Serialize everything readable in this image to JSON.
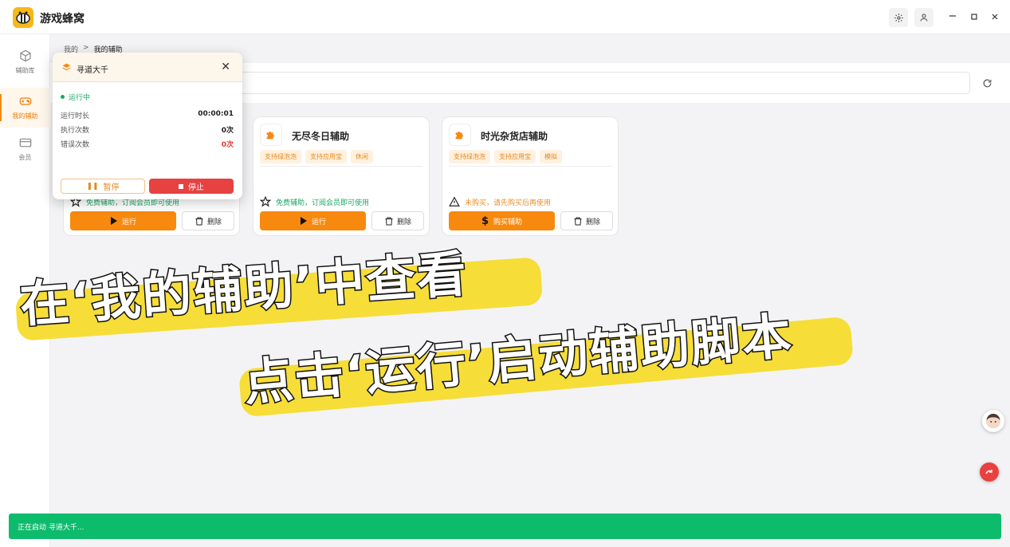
{
  "app": {
    "title": "游戏蜂窝"
  },
  "sidebar": {
    "items": [
      {
        "label": "辅助库",
        "icon": "cube-icon",
        "active": false
      },
      {
        "label": "我的辅助",
        "icon": "gamepad-icon",
        "active": true
      },
      {
        "label": "会员",
        "icon": "card-icon",
        "active": false
      }
    ]
  },
  "breadcrumb": {
    "root": "我的",
    "sep": ">",
    "current": "我的辅助"
  },
  "cards": [
    {
      "title": "",
      "tags": [],
      "note": "免费辅助，订阅会员即可使用",
      "note_type": "ok",
      "primary_label": "运行",
      "secondary_label": "删除"
    },
    {
      "title": "无尽冬日辅助",
      "tags": [
        "支持绿泡泡",
        "支持应用宝",
        "休闲"
      ],
      "note": "免费辅助，订阅会员即可使用",
      "note_type": "ok",
      "primary_label": "运行",
      "secondary_label": "删除"
    },
    {
      "title": "时光杂货店辅助",
      "tags": [
        "支持绿泡泡",
        "支持应用宝",
        "模拟"
      ],
      "note": "未购买，请先购买后再使用",
      "note_type": "warn",
      "primary_label": "购买辅助",
      "secondary_label": "删除"
    }
  ],
  "popup": {
    "title": "寻道大千",
    "status": "运行中",
    "stats": [
      {
        "label": "运行时长",
        "value": "00:00:01",
        "error": false
      },
      {
        "label": "执行次数",
        "value": "0次",
        "error": false
      },
      {
        "label": "错误次数",
        "value": "0次",
        "error": true
      }
    ],
    "pause_label": "暂停",
    "stop_label": "停止"
  },
  "captions": {
    "line1": "在‘我的辅助’中查看",
    "line2": "点击‘运行’启动辅助脚本"
  },
  "toast": {
    "message": "正在启动 寻道大千..."
  },
  "colors": {
    "accent": "#f7890f",
    "success": "#0dbb6c",
    "danger": "#e84141",
    "highlight": "#f5db2d"
  }
}
